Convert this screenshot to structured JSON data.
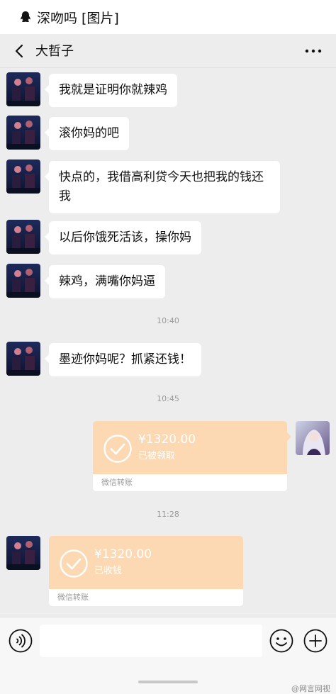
{
  "notification": {
    "app": "QQ",
    "text_prefix": "深吻吗",
    "text_suffix": "[图片]"
  },
  "header": {
    "title": "大哲子"
  },
  "messages": [
    {
      "text": "我就是证明你就辣鸡"
    },
    {
      "text": "滚你妈的吧"
    },
    {
      "text": "快点的，我借高利贷今天也把我的钱还我"
    },
    {
      "text": "以后你饿死活该，操你妈"
    },
    {
      "text": "辣鸡，满嘴你妈逼"
    },
    {
      "text": "墨迹你妈呢？抓紧还钱！"
    }
  ],
  "timestamps": [
    "10:40",
    "10:45",
    "11:28"
  ],
  "transfers": [
    {
      "amount": "¥1320.00",
      "status": "已被领取",
      "footer": "微信转账"
    },
    {
      "amount": "¥1320.00",
      "status": "已收钱",
      "footer": "微信转账"
    }
  ],
  "watermark": "@网言网视",
  "colors": {
    "background": "#ededed",
    "transfer_card": "#fcd9b3",
    "bubble": "#ffffff"
  }
}
